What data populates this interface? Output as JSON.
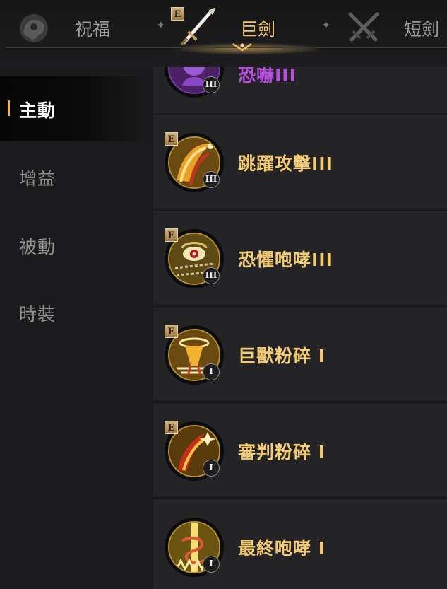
{
  "weapon_tabs": [
    {
      "label": "祝福",
      "icon": "blessing-icon",
      "active": false,
      "badge": ""
    },
    {
      "label": "巨劍",
      "icon": "greatsword-icon",
      "active": true,
      "badge": "E"
    },
    {
      "label": "短劍",
      "icon": "crossed-daggers-icon",
      "active": false,
      "badge": ""
    }
  ],
  "categories": [
    {
      "label": "主動",
      "active": true
    },
    {
      "label": "增益",
      "active": false
    },
    {
      "label": "被動",
      "active": false
    },
    {
      "label": "時裝",
      "active": false
    }
  ],
  "skills": [
    {
      "name": "恐嚇III",
      "rank": "III",
      "badge": "",
      "icon": "intimidate-icon",
      "color": "#b84de0"
    },
    {
      "name": "跳躍攻擊III",
      "rank": "III",
      "badge": "E",
      "icon": "leap-attack-icon",
      "color": "#f2cb74"
    },
    {
      "name": "恐懼咆哮III",
      "rank": "III",
      "badge": "E",
      "icon": "fear-roar-icon",
      "color": "#f2cb74"
    },
    {
      "name": "巨獸粉碎 I",
      "rank": "I",
      "badge": "E",
      "icon": "behemoth-smash-icon",
      "color": "#f2cb74"
    },
    {
      "name": "審判粉碎 I",
      "rank": "I",
      "badge": "E",
      "icon": "judgment-smash-icon",
      "color": "#f2cb74"
    },
    {
      "name": "最終咆哮 I",
      "rank": "I",
      "badge": "",
      "icon": "final-roar-icon",
      "color": "#f2cb74"
    }
  ],
  "colors": {
    "accent": "#f0b74e",
    "skill_gold": "#f2cb74",
    "skill_purple": "#b84de0"
  }
}
